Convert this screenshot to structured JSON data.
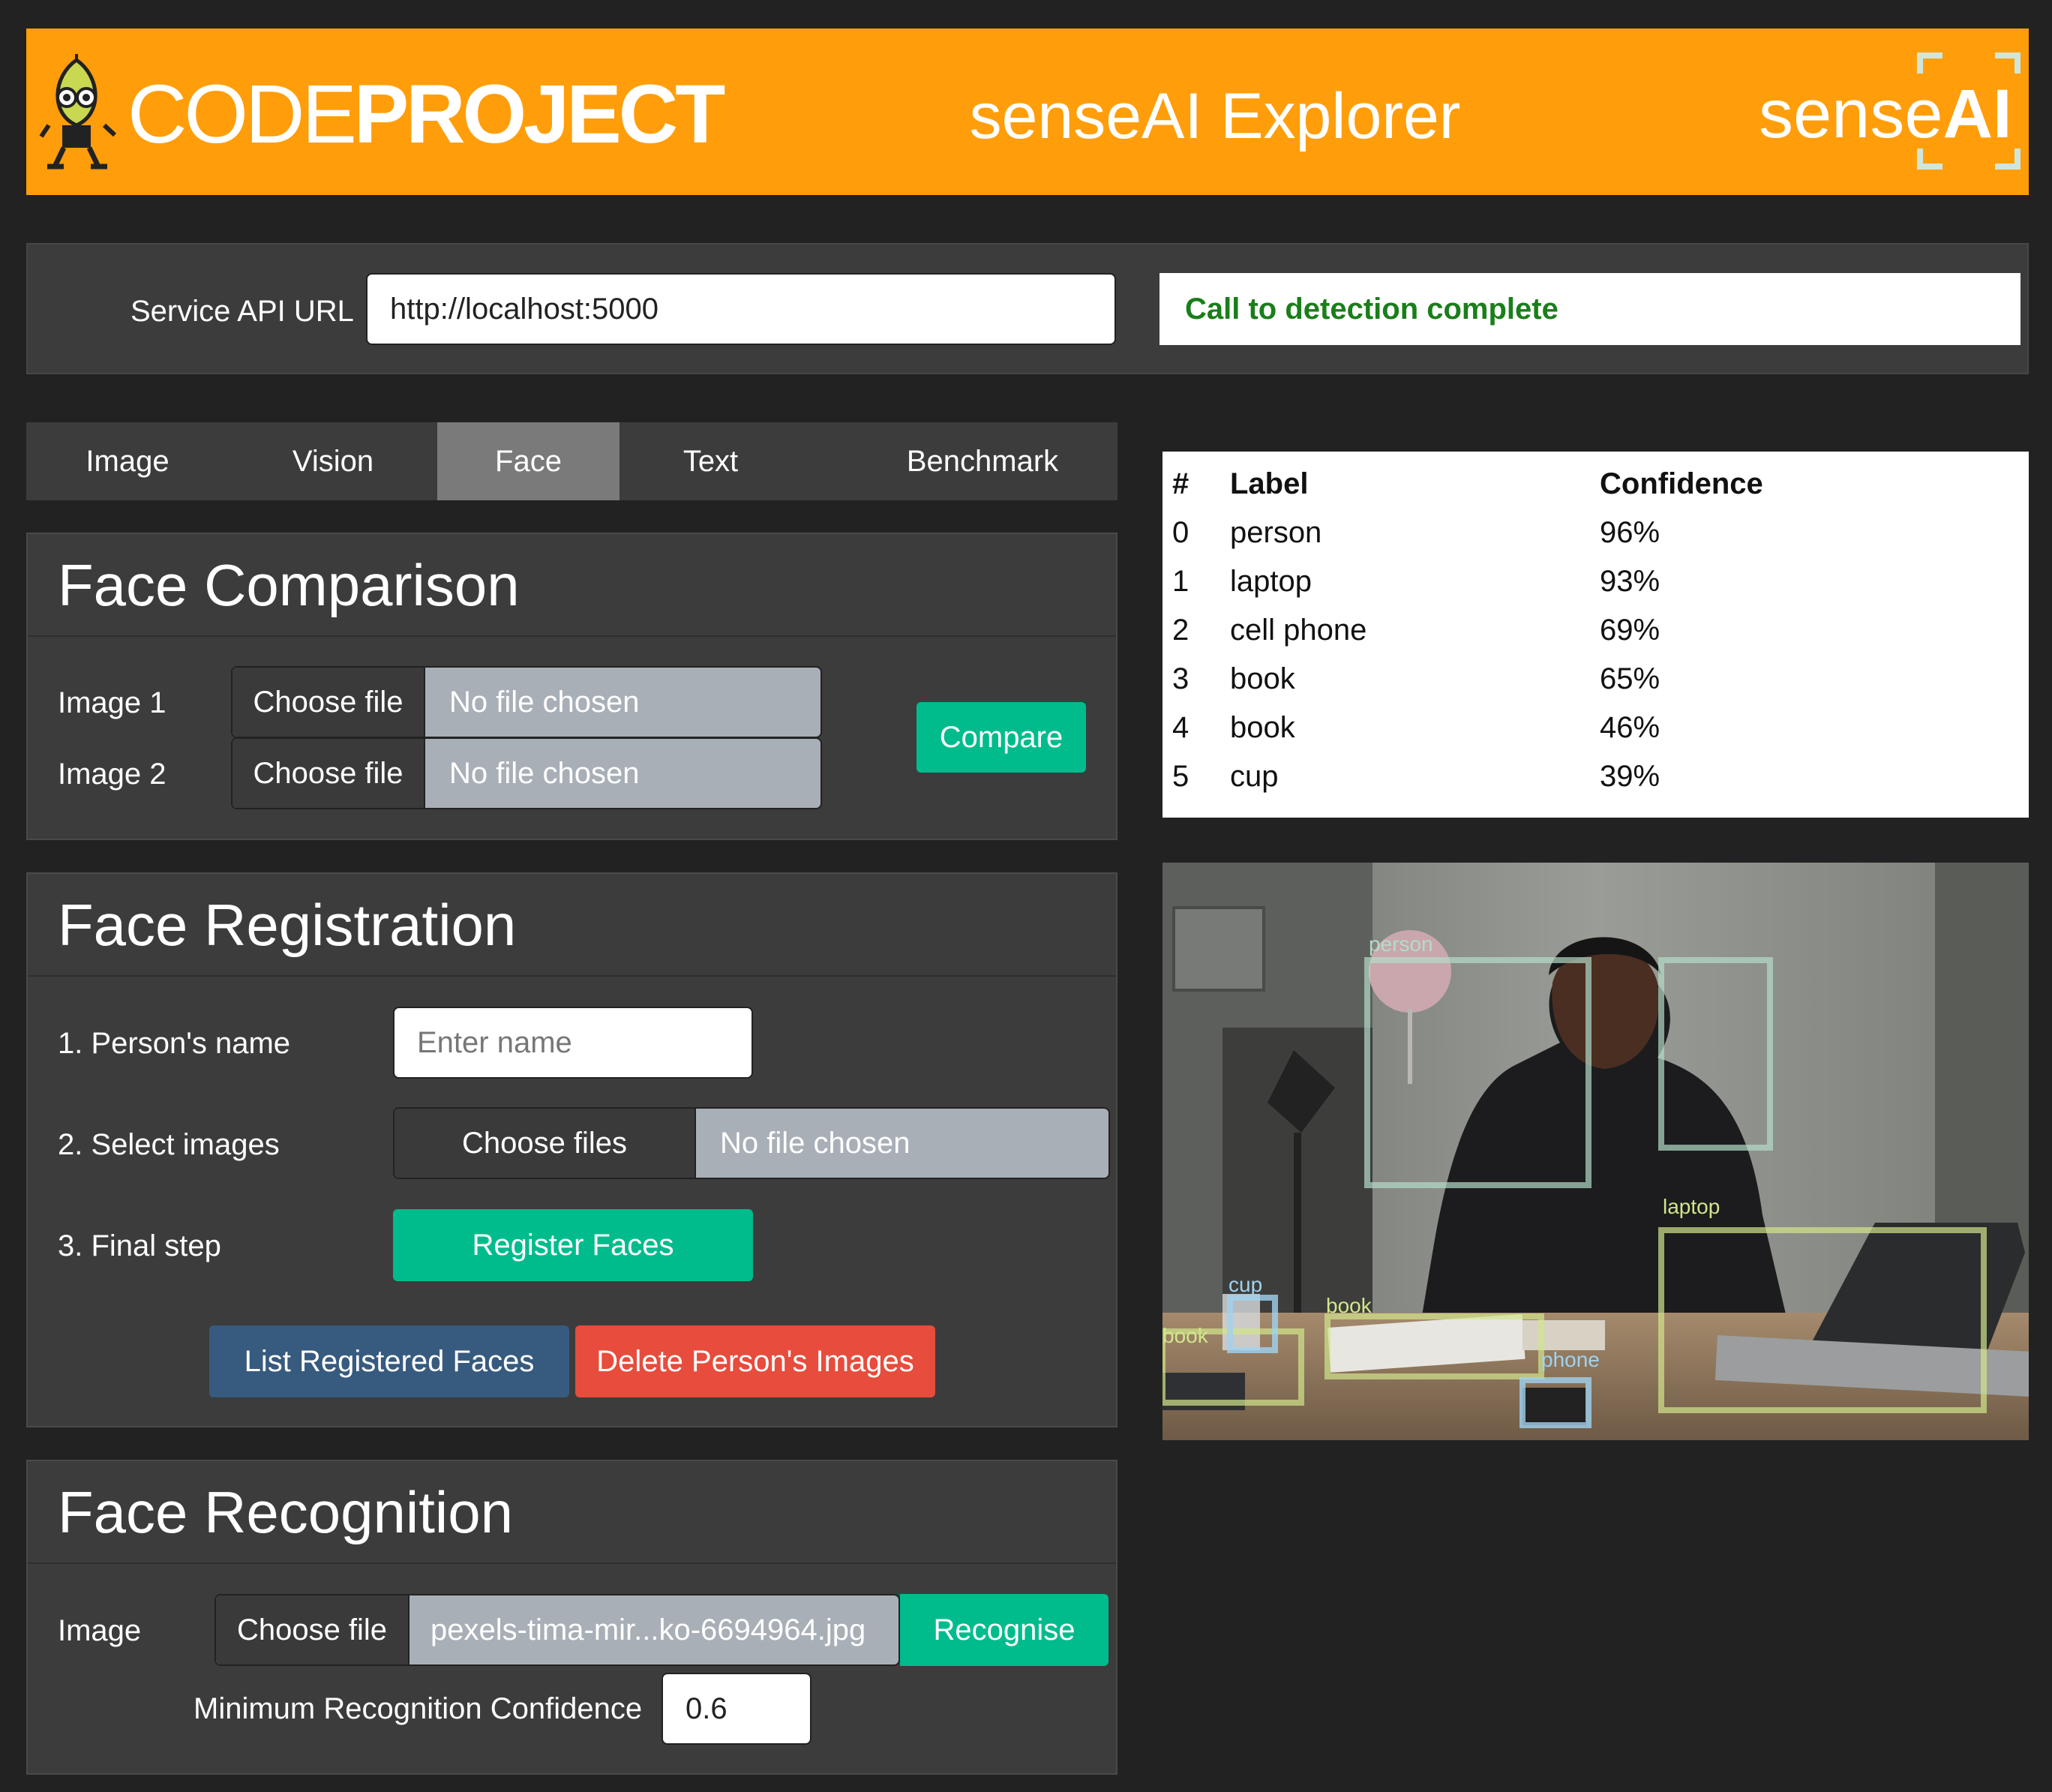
{
  "banner": {
    "brand_left_thin": "CODE",
    "brand_left_bold": "PROJECT",
    "title": "senseAI Explorer",
    "brand_right_thin": "sense",
    "brand_right_bold": "AI",
    "color": "#ff9e0a"
  },
  "api": {
    "label": "Service API URL",
    "url": "http://localhost:5000",
    "status": "Call to detection complete",
    "status_color": "#1a7e1a"
  },
  "tabs": [
    {
      "label": "Image"
    },
    {
      "label": "Vision"
    },
    {
      "label": "Face",
      "active": true
    },
    {
      "label": "Text"
    },
    {
      "label": "Benchmark"
    }
  ],
  "face_comparison": {
    "title": "Face Comparison",
    "image1_label": "Image 1",
    "image2_label": "Image 2",
    "choose_file": "Choose file",
    "no_file": "No file chosen",
    "compare_button": "Compare"
  },
  "face_registration": {
    "title": "Face Registration",
    "step1_label": "1. Person's name",
    "name_placeholder": "Enter name",
    "step2_label": "2. Select images",
    "choose_files": "Choose files",
    "no_file": "No file chosen",
    "step3_label": "3. Final step",
    "register_button": "Register Faces",
    "list_button": "List Registered Faces",
    "delete_button": "Delete Person's Images"
  },
  "face_recognition": {
    "title": "Face Recognition",
    "image_label": "Image",
    "choose_file": "Choose file",
    "file_name": "pexels-tima-mir...ko-6694964.jpg",
    "recognise_button": "Recognise",
    "min_conf_label": "Minimum Recognition Confidence",
    "min_conf_value": "0.6"
  },
  "results": {
    "headers": [
      "#",
      "Label",
      "Confidence"
    ],
    "rows": [
      {
        "idx": "0",
        "label": "person",
        "conf": "96%"
      },
      {
        "idx": "1",
        "label": "laptop",
        "conf": "93%"
      },
      {
        "idx": "2",
        "label": "cell phone",
        "conf": "69%"
      },
      {
        "idx": "3",
        "label": "book",
        "conf": "65%"
      },
      {
        "idx": "4",
        "label": "book",
        "conf": "46%"
      },
      {
        "idx": "5",
        "label": "cup",
        "conf": "39%"
      }
    ]
  },
  "detections": {
    "labels": [
      "person",
      "laptop",
      "cup",
      "book",
      "book",
      "phone"
    ],
    "colors": {
      "person": "#b4dcc8",
      "laptop": "#d2e68c",
      "cup": "#a0d2f0",
      "book": "#d2e68c",
      "phone": "#a0d2f0"
    }
  }
}
